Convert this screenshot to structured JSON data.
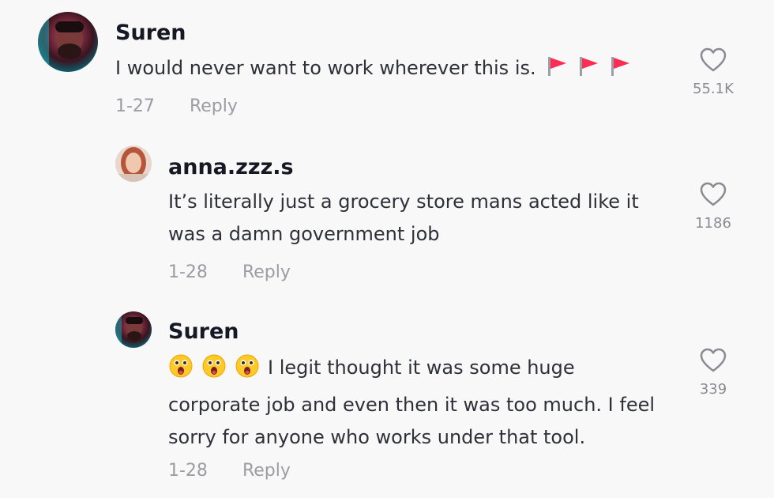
{
  "comments": [
    {
      "username": "Suren",
      "text": "I would never want to work wherever this is.",
      "emoji_suffix": [
        "red-flag-icon",
        "red-flag-icon",
        "red-flag-icon"
      ],
      "date": "1-27",
      "reply_label": "Reply",
      "likes": "55.1K"
    },
    {
      "username": "anna.zzz.s",
      "text": "It’s literally just a grocery store mans acted like it was a damn government job",
      "date": "1-28",
      "reply_label": "Reply",
      "likes": "1186"
    },
    {
      "username": "Suren",
      "emoji_prefix": [
        "astonished-face-icon",
        "astonished-face-icon",
        "astonished-face-icon"
      ],
      "text": "I legit thought it was some huge corporate job and even then it was too much. I feel sorry for anyone who works under that tool.",
      "date": "1-28",
      "reply_label": "Reply",
      "likes": "339"
    }
  ],
  "colors": {
    "background": "#f8f8f8",
    "username": "#161823",
    "text": "#2f3038",
    "meta": "#9c9ca1",
    "flag": "#fe2c55"
  }
}
